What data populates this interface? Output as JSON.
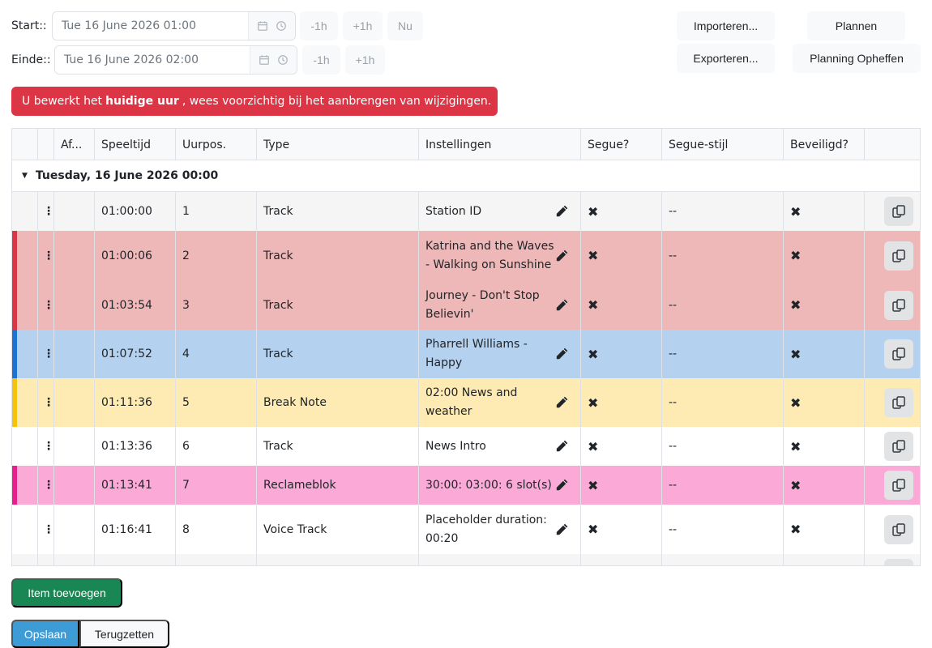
{
  "schedule": {
    "start_label": "Start::",
    "start_value": "Tue 16 June 2026 01:00",
    "end_label": "Einde::",
    "end_value": "Tue 16 June 2026 02:00",
    "minus_1h": "-1h",
    "plus_1h": "+1h",
    "now": "Nu"
  },
  "actions": {
    "import": "Importeren...",
    "export": "Exporteren...",
    "plan": "Plannen",
    "unplan": "Planning Opheffen"
  },
  "alert": {
    "prefix": "U bewerkt het",
    "bold": "huidige uur",
    "suffix": ", wees voorzichtig bij het aanbrengen van wijzigingen."
  },
  "table": {
    "headers": {
      "af": "Af...",
      "playtime": "Speeltijd",
      "hourpos": "Uurpos.",
      "type": "Type",
      "settings": "Instellingen",
      "segue": "Segue?",
      "segue_style": "Segue-stijl",
      "protected": "Beveiligd?"
    },
    "group_label": "Tuesday, 16 June 2026 00:00",
    "drag_glyph": "⋮..",
    "rows": [
      {
        "time": "01:00:00",
        "pos": "1",
        "type": "Track",
        "settings": "Station ID",
        "segue": "✖",
        "style": "--",
        "protected": "✖",
        "bg": "#f5f5f5",
        "stripe": ""
      },
      {
        "time": "01:00:06",
        "pos": "2",
        "type": "Track",
        "settings": "Katrina and the Waves - Walking on Sunshine",
        "segue": "✖",
        "style": "--",
        "protected": "✖",
        "bg": "#efb8b8",
        "stripe": "#dc3545"
      },
      {
        "time": "01:03:54",
        "pos": "3",
        "type": "Track",
        "settings": "Journey - Don't Stop Believin'",
        "segue": "✖",
        "style": "--",
        "protected": "✖",
        "bg": "#efb8b8",
        "stripe": "#dc3545"
      },
      {
        "time": "01:07:52",
        "pos": "4",
        "type": "Track",
        "settings": "Pharrell Williams - Happy",
        "segue": "✖",
        "style": "--",
        "protected": "✖",
        "bg": "#b4d1f0",
        "stripe": "#1e73d2"
      },
      {
        "time": "01:11:36",
        "pos": "5",
        "type": "Break Note",
        "settings": "02:00 News and weather",
        "segue": "✖",
        "style": "--",
        "protected": "✖",
        "bg": "#fdebb3",
        "stripe": "#f5c211"
      },
      {
        "time": "01:13:36",
        "pos": "6",
        "type": "Track",
        "settings": "News Intro",
        "segue": "✖",
        "style": "--",
        "protected": "✖",
        "bg": "#ffffff",
        "stripe": ""
      },
      {
        "time": "01:13:41",
        "pos": "7",
        "type": "Reclameblok",
        "settings": "30:00: 03:00: 6 slot(s)",
        "segue": "✖",
        "style": "--",
        "protected": "✖",
        "bg": "#fbaad8",
        "stripe": "#e91e8c"
      },
      {
        "time": "01:16:41",
        "pos": "8",
        "type": "Voice Track",
        "settings": "Placeholder duration: 00:20",
        "segue": "✖",
        "style": "--",
        "protected": "✖",
        "bg": "#ffffff",
        "stripe": ""
      }
    ]
  },
  "footer": {
    "add_item": "Item toevoegen",
    "save": "Opslaan",
    "reset": "Terugzetten"
  }
}
